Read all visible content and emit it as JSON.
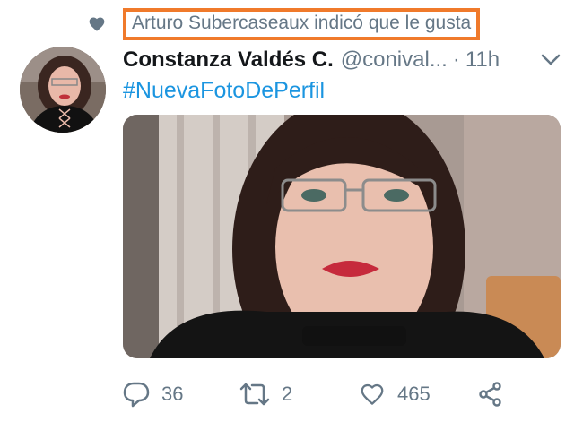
{
  "social_context": {
    "icon": "heart-icon",
    "text": "Arturo Subercaseaux indicó que le gusta"
  },
  "tweet": {
    "author_name": "Constanza Valdés C.",
    "handle": "@conival...",
    "separator": "·",
    "time": "11h",
    "hashtag": "#NuevaFotoDePerfil"
  },
  "actions": {
    "reply_count": "36",
    "retweet_count": "2",
    "like_count": "465"
  },
  "colors": {
    "highlight_border": "#f07a2b",
    "link": "#1b95e0",
    "muted": "#657786",
    "text": "#14171a"
  }
}
